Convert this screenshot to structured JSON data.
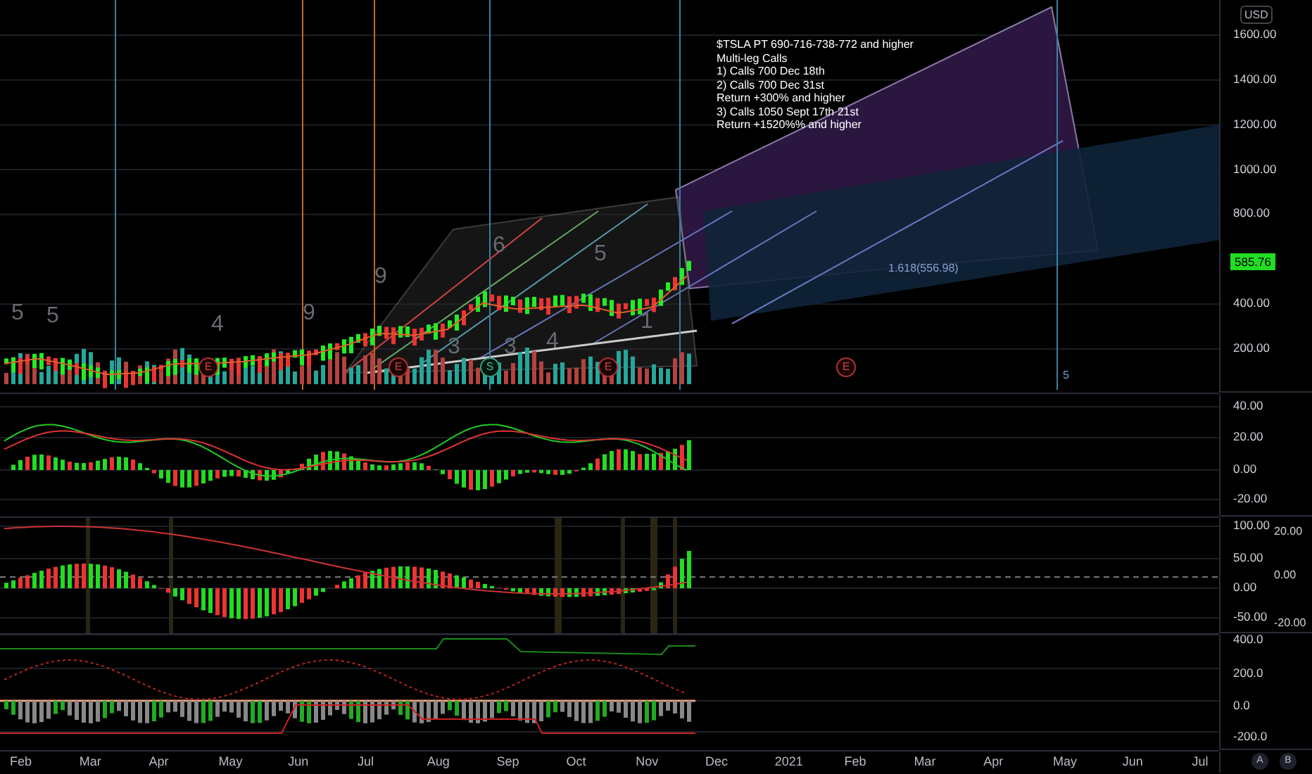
{
  "price_pane": {
    "currency": "USD",
    "last_price": "585.76",
    "annotation": [
      "$TSLA PT 690-716-738-772 and higher",
      "Multi-leg Calls",
      "1) Calls 700 Dec 18th",
      "2) Calls 700 Dec 31st",
      "Return +300% and higher",
      "3) Calls 1050 Sept 17th 21st",
      "Return +1520%% and higher"
    ],
    "fib_label": "1.618(556.98)",
    "counts": [
      "5",
      "5",
      "4",
      "9",
      "9",
      "6",
      "5",
      "3",
      "3",
      "4",
      "1"
    ],
    "wave_label": "5",
    "events": [
      {
        "kind": "earnings",
        "label": "E"
      },
      {
        "kind": "earnings",
        "label": "E"
      },
      {
        "kind": "split",
        "label": "S"
      },
      {
        "kind": "earnings",
        "label": "E"
      },
      {
        "kind": "earnings",
        "label": "E"
      }
    ],
    "axis_ticks": [
      "1600.00",
      "1400.00",
      "1200.00",
      "1000.00",
      "800.00",
      "400.00",
      "200.00"
    ]
  },
  "macd_pane": {
    "ticks": [
      "40.00",
      "20.00",
      "0.00",
      "-20.00"
    ]
  },
  "momentum_pane": {
    "ticks": [
      "100.00",
      "50.00",
      "0.00",
      "-50.00"
    ],
    "right_ticks": [
      "20.00",
      "0.00",
      "-20.00"
    ]
  },
  "oscillator_pane": {
    "ticks": [
      "400.0",
      "200.0",
      "0.0",
      "-200.0"
    ]
  },
  "time_axis": {
    "labels": [
      "Feb",
      "Mar",
      "Apr",
      "May",
      "Jun",
      "Jul",
      "Aug",
      "Sep",
      "Oct",
      "Nov",
      "Dec",
      "2021",
      "Feb",
      "Mar",
      "Apr",
      "May",
      "Jun",
      "Jul"
    ],
    "scale_buttons": [
      "A",
      "B"
    ]
  }
}
